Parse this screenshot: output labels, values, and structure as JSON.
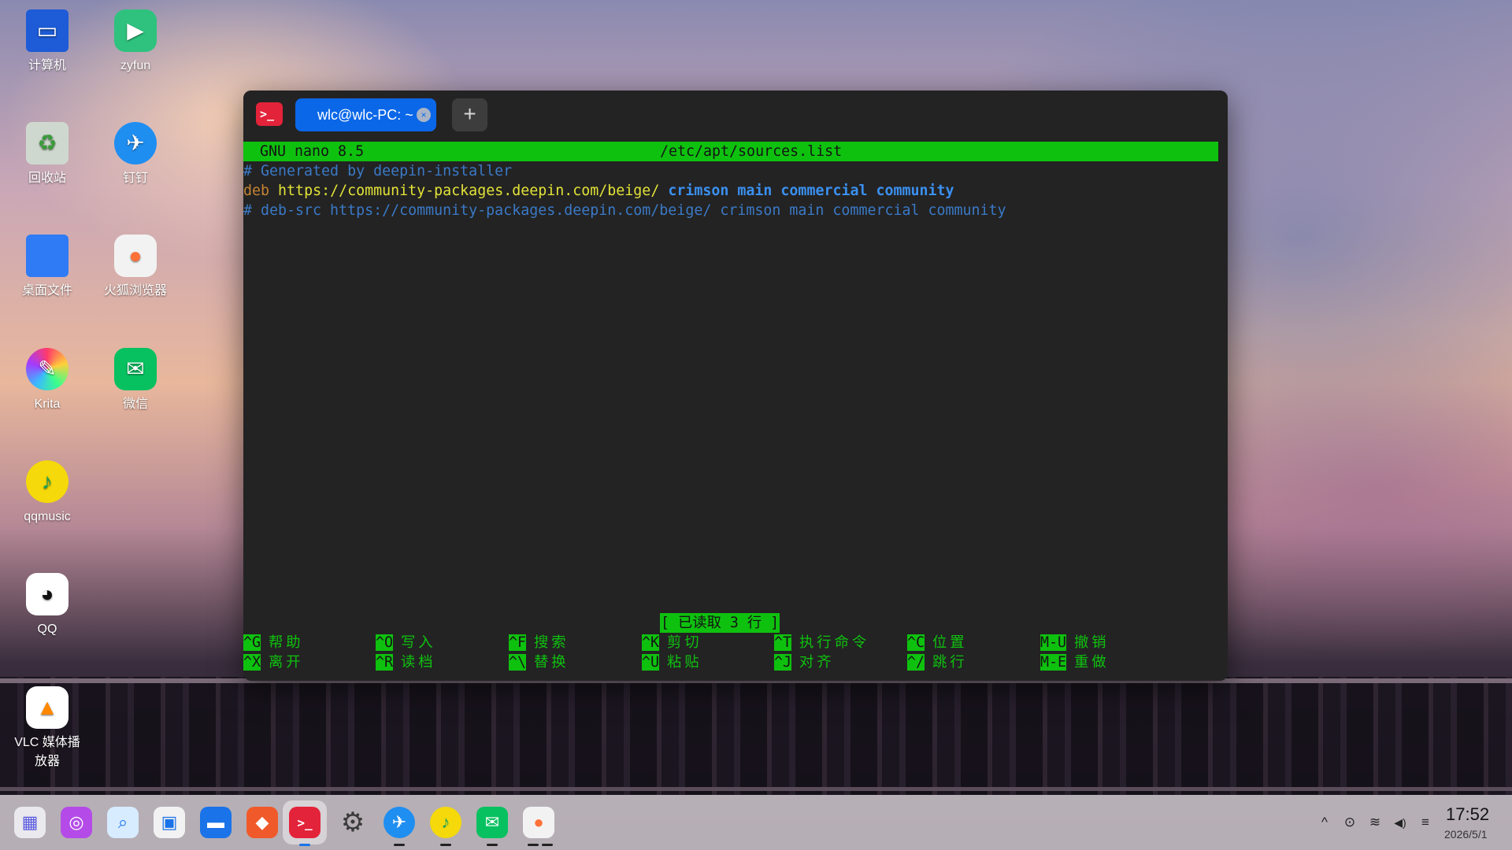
{
  "desktop": {
    "icons": [
      {
        "label": "计算机",
        "icon": "computer-icon",
        "color": "#1e5bd6"
      },
      {
        "label": "zyfun",
        "icon": "zyfun-icon",
        "color": "#2ec27e"
      },
      {
        "label": "回收站",
        "icon": "trash-icon",
        "color": "#cfd8cf"
      },
      {
        "label": "钉钉",
        "icon": "dingtalk-icon",
        "color": "#1f8ef1"
      },
      {
        "label": "桌面文件",
        "icon": "folder-icon",
        "color": "#2f7bf5"
      },
      {
        "label": "火狐浏览器",
        "icon": "firefox-icon",
        "color": "#f2f2f2"
      },
      {
        "label": "Krita",
        "icon": "krita-icon",
        "color": "#7b3fe4"
      },
      {
        "label": "微信",
        "icon": "wechat-icon",
        "color": "#07c160"
      },
      {
        "label": "qqmusic",
        "icon": "qqmusic-icon",
        "color": "#f5d90a"
      },
      {
        "label": "QQ",
        "icon": "qq-icon",
        "color": "#ffffff"
      },
      {
        "label": "VLC 媒体播放器",
        "icon": "vlc-icon",
        "color": "#ffffff"
      }
    ]
  },
  "terminal": {
    "tab_title": "wlc@wlc-PC: ~",
    "tab_close": "×",
    "add_tab": "+",
    "menu": "☰",
    "minimize": "─",
    "maximize": "☐",
    "close": "✕",
    "nano": {
      "version": "GNU nano 8.5",
      "filename": "/etc/apt/sources.list",
      "lines": {
        "line1": "# Generated by deepin-installer",
        "line2_deb": "deb",
        "line2_url": "https://community-packages.deepin.com/beige/",
        "line2_rest": "crimson main commercial community",
        "line3": "# deb-src https://community-packages.deepin.com/beige/ crimson main commercial community"
      },
      "status": "[ 已读取 3 行 ]",
      "shortcuts": [
        {
          "key": "^G",
          "desc": "帮助"
        },
        {
          "key": "^O",
          "desc": "写入"
        },
        {
          "key": "^F",
          "desc": "搜索"
        },
        {
          "key": "^K",
          "desc": "剪切"
        },
        {
          "key": "^T",
          "desc": "执行命令"
        },
        {
          "key": "^C",
          "desc": "位置"
        },
        {
          "key": "M-U",
          "desc": "撤销"
        },
        {
          "key": "^X",
          "desc": "离开"
        },
        {
          "key": "^R",
          "desc": "读档"
        },
        {
          "key": "^\\",
          "desc": "替换"
        },
        {
          "key": "^U",
          "desc": "粘贴"
        },
        {
          "key": "^J",
          "desc": "对齐"
        },
        {
          "key": "^/",
          "desc": "跳行"
        },
        {
          "key": "M-E",
          "desc": "重做"
        }
      ]
    }
  },
  "taskbar": {
    "apps": [
      {
        "name": "launcher-icon",
        "glyph": "▦",
        "color": "#e9e9ee"
      },
      {
        "name": "deepin-ai-icon",
        "glyph": "◎",
        "color": "#b44be8"
      },
      {
        "name": "search-icon",
        "glyph": "⌕",
        "color": "#d7ecff"
      },
      {
        "name": "multitask-icon",
        "glyph": "▣",
        "color": "#f2f2f2"
      },
      {
        "name": "file-manager-icon",
        "glyph": "▬",
        "color": "#1a73e8"
      },
      {
        "name": "app-store-icon",
        "glyph": "◆",
        "color": "#f05a2b"
      },
      {
        "name": "terminal-icon",
        "glyph": ">_",
        "color": "#e3233a"
      },
      {
        "name": "settings-icon",
        "glyph": "⚙",
        "color": "#3a3a3a"
      },
      {
        "name": "dingtalk-icon",
        "glyph": "✈",
        "color": "#1f8ef1"
      },
      {
        "name": "qqmusic-icon",
        "glyph": "♪",
        "color": "#f5d90a"
      },
      {
        "name": "wechat-icon",
        "glyph": "✉",
        "color": "#07c160"
      },
      {
        "name": "firefox-icon",
        "glyph": "●",
        "color": "#ff7139"
      }
    ],
    "tray": {
      "expand": "^",
      "vpn": "⊙",
      "wifi": "≋",
      "volume": "◀)",
      "toggle": "≡"
    },
    "clock": {
      "time": "17:52",
      "date": "2026/5/1"
    }
  }
}
